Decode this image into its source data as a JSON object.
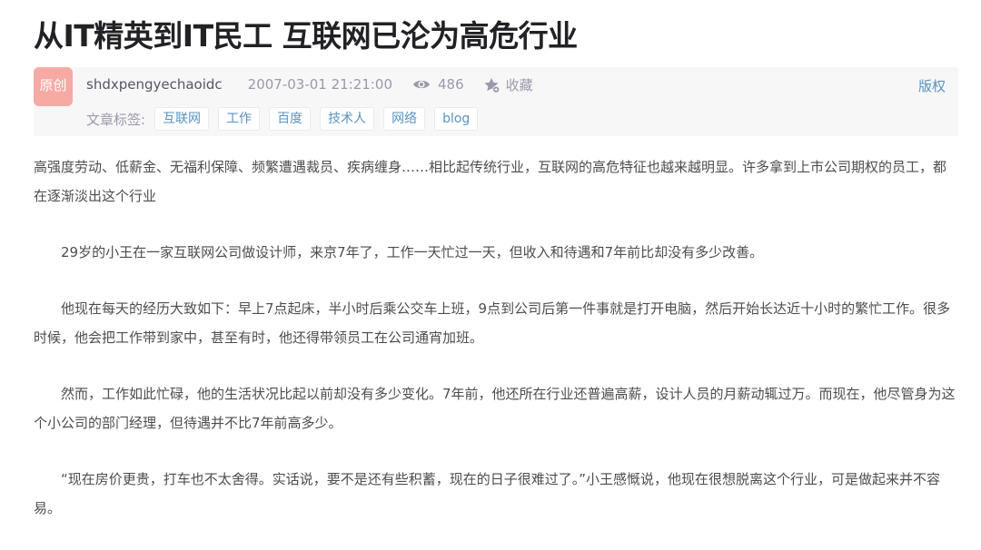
{
  "article": {
    "title": "从IT精英到IT民工 互联网已沦为高危行业"
  },
  "meta": {
    "badge": "原创",
    "author": "shdxpengyechaoidc",
    "date": "2007-03-01 21:21:00",
    "views": "486",
    "favorite_label": "收藏",
    "copyright_label": "版权",
    "tags_label": "文章标签:",
    "tags": [
      "互联网",
      "工作",
      "百度",
      "技术人",
      "网络",
      "blog"
    ],
    "icons": {
      "views": "eye-icon",
      "favorite": "star-icon"
    },
    "colors": {
      "badge": "#f7a9a4",
      "link": "#5893c2",
      "meta_bg": "#f7f7f8"
    }
  },
  "content": {
    "paragraphs": [
      "高强度劳动、低薪金、无福利保障、频繁遭遇裁员、疾病缠身……相比起传统行业，互联网的高危特征也越来越明显。许多拿到上市公司期权的员工，都在逐渐淡出这个行业",
      "29岁的小王在一家互联网公司做设计师，来京7年了，工作一天忙过一天，但收入和待遇和7年前比却没有多少改善。",
      "他现在每天的经历大致如下：早上7点起床，半小时后乘公交车上班，9点到公司后第一件事就是打开电脑，然后开始长达近十小时的繁忙工作。很多时候，他会把工作带到家中，甚至有时，他还得带领员工在公司通宵加班。",
      "然而，工作如此忙碌，他的生活状况比起以前却没有多少变化。7年前，他还所在行业还普遍高薪，设计人员的月薪动辄过万。而现在，他尽管身为这个小公司的部门经理，但待遇并不比7年前高多少。",
      "“现在房价更贵，打车也不太舍得。实话说，要不是还有些积蓄，现在的日子很难过了。”小王感慨说，他现在很想脱离这个行业，可是做起来并不容易。"
    ]
  }
}
